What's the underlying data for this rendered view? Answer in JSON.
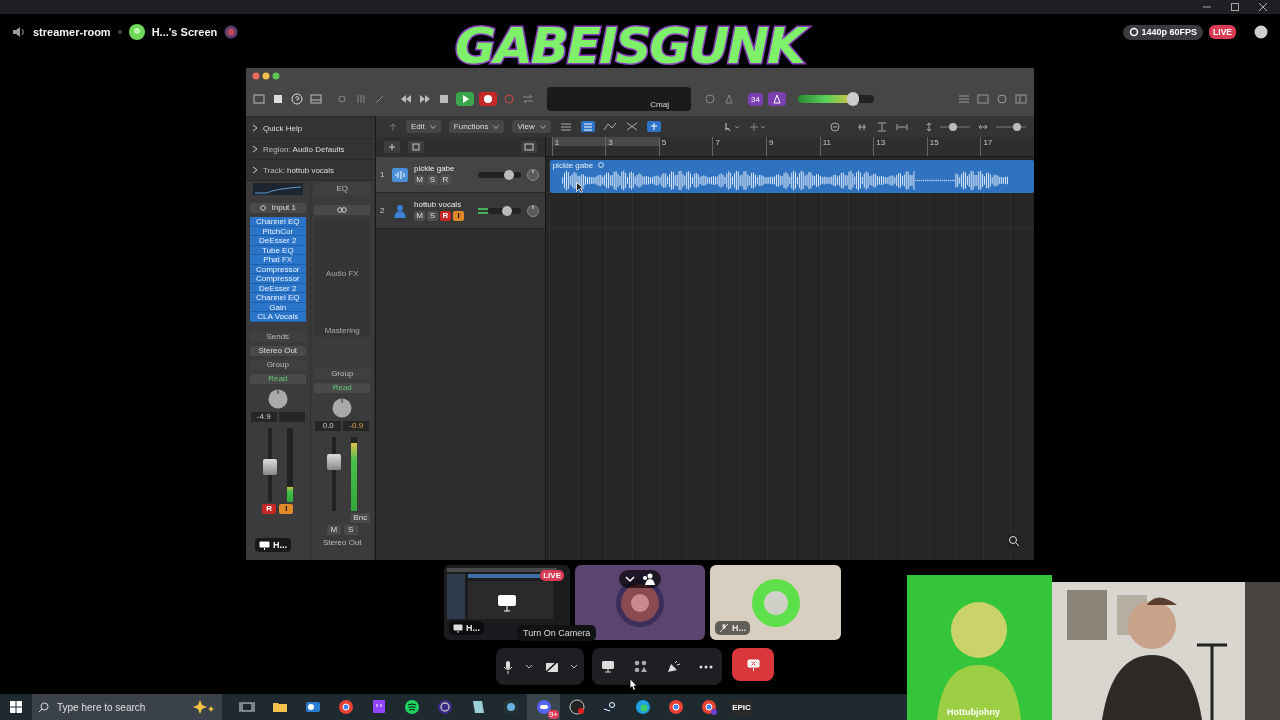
{
  "header": {
    "channel": "streamer-room",
    "stream_title": "H...'s Screen",
    "quality": "1440p 60FPS",
    "live": "LIVE"
  },
  "logo": "GABEISGUNK",
  "daw": {
    "inspector": [
      {
        "label": "Quick Help"
      },
      {
        "label": "Region:",
        "value": "Audio Defaults"
      },
      {
        "label": "Track:",
        "value": "hottub vocals"
      }
    ],
    "key": "Cmaj",
    "badge": "34",
    "master_volume": {
      "level": 0.72
    },
    "menus": [
      "Edit",
      "Functions",
      "View"
    ],
    "zoom": [
      {
        "kind": "vertical",
        "level": 0.4
      },
      {
        "kind": "horizontal",
        "level": 0.78
      }
    ],
    "ruler": [
      "1",
      "3",
      "5",
      "7",
      "9",
      "11",
      "13",
      "15",
      "17"
    ],
    "tracks": [
      {
        "number": "1",
        "name": "pickle gabe",
        "kind": "audio",
        "buttons": [
          {
            "label": "M"
          },
          {
            "label": "S"
          },
          {
            "label": "R",
            "kind": "record",
            "on": false
          }
        ],
        "volume": {
          "level": 0.8
        },
        "region": "pickle gabe"
      },
      {
        "number": "2",
        "name": "hottub vocals",
        "kind": "vocal",
        "buttons": [
          {
            "label": "M"
          },
          {
            "label": "S"
          },
          {
            "label": "R",
            "kind": "record",
            "on": true
          },
          {
            "label": "I",
            "kind": "input",
            "on": true
          }
        ],
        "volume": {
          "level": 0.6
        }
      }
    ],
    "strips": [
      {
        "kind": "track",
        "input": "Input 1",
        "plugins": [
          "Channel EQ",
          "PitchCor",
          "DeEsser 2",
          "Tube EQ",
          "Phat FX",
          "Compressor",
          "Compressor",
          "DeEsser 2",
          "Channel EQ",
          "Gain",
          "CLA Vocals"
        ],
        "sends": "Sends",
        "output": "Stereo Out",
        "group": "Group",
        "automation": "Read",
        "readouts": [
          "-4.9"
        ],
        "fader": {
          "level": 0.45
        },
        "meter": {
          "level": 0.2
        },
        "buttons": [
          {
            "label": "R",
            "kind": "record",
            "on": true
          },
          {
            "label": "I",
            "kind": "input",
            "on": true
          }
        ]
      },
      {
        "kind": "master",
        "eq": "EQ",
        "audio_fx": "Audio FX",
        "mastering": "Mastering",
        "group": "Group",
        "automation": "Read",
        "readouts": [
          "0.0",
          "-0.9"
        ],
        "fader": {
          "level": 0.7
        },
        "meter": {
          "level": 0.92
        },
        "buttons": [
          {
            "label": "Bnc",
            "kind": "bounce",
            "on": false
          }
        ],
        "mute_solo": [
          {
            "label": "M"
          },
          {
            "label": "S"
          }
        ],
        "name": "Stereo Out"
      }
    ],
    "overlay_label": "H..."
  },
  "tiles": [
    {
      "kind": "stream",
      "live": "LIVE",
      "label": "H..."
    },
    {
      "kind": "host"
    },
    {
      "kind": "member",
      "label": "H..."
    }
  ],
  "tooltip": "Turn On Camera",
  "taskbar": {
    "search_placeholder": "Type here to search",
    "badge": "9+",
    "epic": "EPIC"
  },
  "webcam": {
    "name": "Hottubjohny"
  }
}
